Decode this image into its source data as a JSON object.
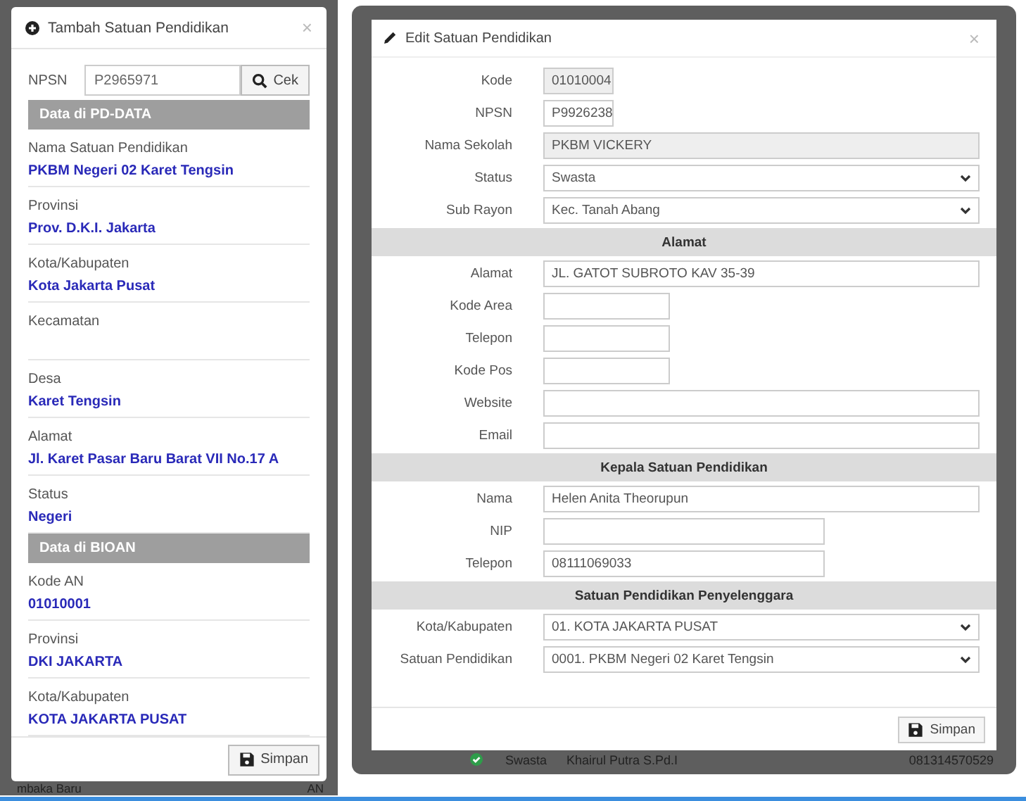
{
  "tambah_dialog": {
    "title": "Tambah Satuan Pendidikan",
    "close": "×",
    "npsn_label": "NPSN",
    "npsn_value": "P2965971",
    "check_button": "Cek",
    "sections": [
      {
        "title": "Data di PD-DATA",
        "items": [
          {
            "label": "Nama Satuan Pendidikan",
            "value": "PKBM Negeri 02 Karet Tengsin"
          },
          {
            "label": "Provinsi",
            "value": "Prov. D.K.I. Jakarta"
          },
          {
            "label": "Kota/Kabupaten",
            "value": "Kota Jakarta Pusat"
          },
          {
            "label": "Kecamatan"
          },
          {
            "label": "Desa",
            "value": "Karet Tengsin"
          },
          {
            "label": "Alamat",
            "value": "Jl. Karet Pasar Baru Barat VII No.17 A"
          },
          {
            "label": "Status",
            "value": "Negeri"
          }
        ]
      },
      {
        "title": "Data di BIOAN",
        "items": [
          {
            "label": "Kode AN",
            "value": "01010001"
          },
          {
            "label": "Provinsi",
            "value": "DKI JAKARTA"
          },
          {
            "label": "Kota/Kabupaten",
            "value": "KOTA JAKARTA PUSAT"
          }
        ]
      }
    ],
    "save_button": "Simpan"
  },
  "left_background_row": {
    "text": "mbaka Baru",
    "column_2": "AN"
  },
  "edit_dialog": {
    "title": "Edit Satuan Pendidikan",
    "close": "×",
    "rows": [
      {
        "kind": "field",
        "label": "Kode",
        "value": "01010004",
        "disabled": true
      },
      {
        "kind": "field",
        "label": "NPSN",
        "value": "P9926238",
        "disabled": false
      },
      {
        "kind": "field",
        "label": "Nama Sekolah",
        "value": "PKBM VICKERY",
        "disabled": true
      },
      {
        "kind": "select",
        "label": "Status",
        "value": "Swasta"
      },
      {
        "kind": "select",
        "label": "Sub Rayon",
        "value": "Kec. Tanah Abang"
      },
      {
        "kind": "header",
        "label": "Alamat"
      },
      {
        "kind": "field",
        "label": "Alamat",
        "value": "JL. GATOT SUBROTO KAV 35-39",
        "disabled": false
      },
      {
        "kind": "field",
        "label": "Kode Area",
        "disabled": false
      },
      {
        "kind": "field",
        "label": "Telepon",
        "disabled": false
      },
      {
        "kind": "field",
        "label": "Kode Pos",
        "disabled": false
      },
      {
        "kind": "field",
        "label": "Website",
        "disabled": false
      },
      {
        "kind": "field",
        "label": "Email",
        "disabled": false
      },
      {
        "kind": "header",
        "label": "Kepala Satuan Pendidikan"
      },
      {
        "kind": "field",
        "label": "Nama",
        "value": "Helen Anita Theorupun",
        "disabled": false
      },
      {
        "kind": "field",
        "label": "NIP",
        "disabled": false
      },
      {
        "kind": "field",
        "label": "Telepon",
        "value": "08111069033",
        "disabled": false
      },
      {
        "kind": "header",
        "label": "Satuan Pendidikan Penyelenggara"
      },
      {
        "kind": "select",
        "label": "Kota/Kabupaten",
        "value": "01. KOTA JAKARTA PUSAT"
      },
      {
        "kind": "select",
        "label": "Satuan Pendidikan",
        "value": "0001. PKBM Negeri 02 Karet Tengsin"
      }
    ],
    "save_button": "Simpan"
  },
  "right_background_row": {
    "status": "Swasta",
    "name": "Khairul Putra S.Pd.I",
    "phone": "081314570529"
  }
}
